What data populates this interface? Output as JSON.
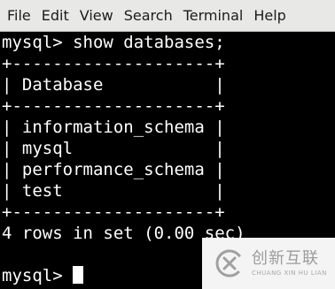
{
  "menubar": {
    "items": [
      "File",
      "Edit",
      "View",
      "Search",
      "Terminal",
      "Help"
    ]
  },
  "terminal": {
    "lines": [
      "mysql> show databases;",
      "+--------------------+",
      "| Database           |",
      "+--------------------+",
      "| information_schema |",
      "| mysql              |",
      "| performance_schema |",
      "| test               |",
      "+--------------------+",
      "4 rows in set (0.00 sec)",
      ""
    ],
    "prompt": "mysql> "
  },
  "watermark": {
    "title": "创新互联",
    "subtitle": "CHUANG XIN HU LIAN"
  },
  "colors": {
    "menubar_bg": "#e8e8e7",
    "terminal_bg": "#000000",
    "terminal_fg": "#ffffff",
    "watermark_bg": "#f4f4f4",
    "watermark_fg": "#9c9c9c"
  }
}
